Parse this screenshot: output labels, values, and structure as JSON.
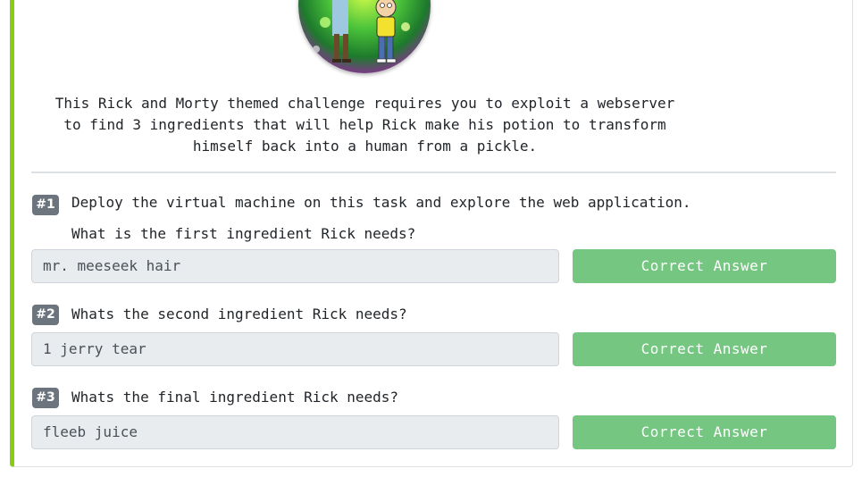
{
  "room": {
    "description": "This Rick and Morty themed challenge requires you to exploit a webserver\nto find 3 ingredients that will help Rick make his potion to transform\nhimself back into a human from a pickle.",
    "accent_color": "#88cc14"
  },
  "questions": [
    {
      "number": "#1",
      "task_text": "Deploy the virtual machine on this task and explore the web application.",
      "question": "What is the first ingredient Rick needs?",
      "answer": "mr. meeseek hair",
      "button_label": "Correct Answer"
    },
    {
      "number": "#2",
      "question": "Whats the second ingredient Rick needs?",
      "answer": "1 jerry tear",
      "button_label": "Correct Answer"
    },
    {
      "number": "#3",
      "question": "Whats the final ingredient Rick needs?",
      "answer": "fleeb juice",
      "button_label": "Correct Answer"
    }
  ],
  "colors": {
    "correct_button": "#74c681",
    "question_badge": "#6c757d"
  }
}
